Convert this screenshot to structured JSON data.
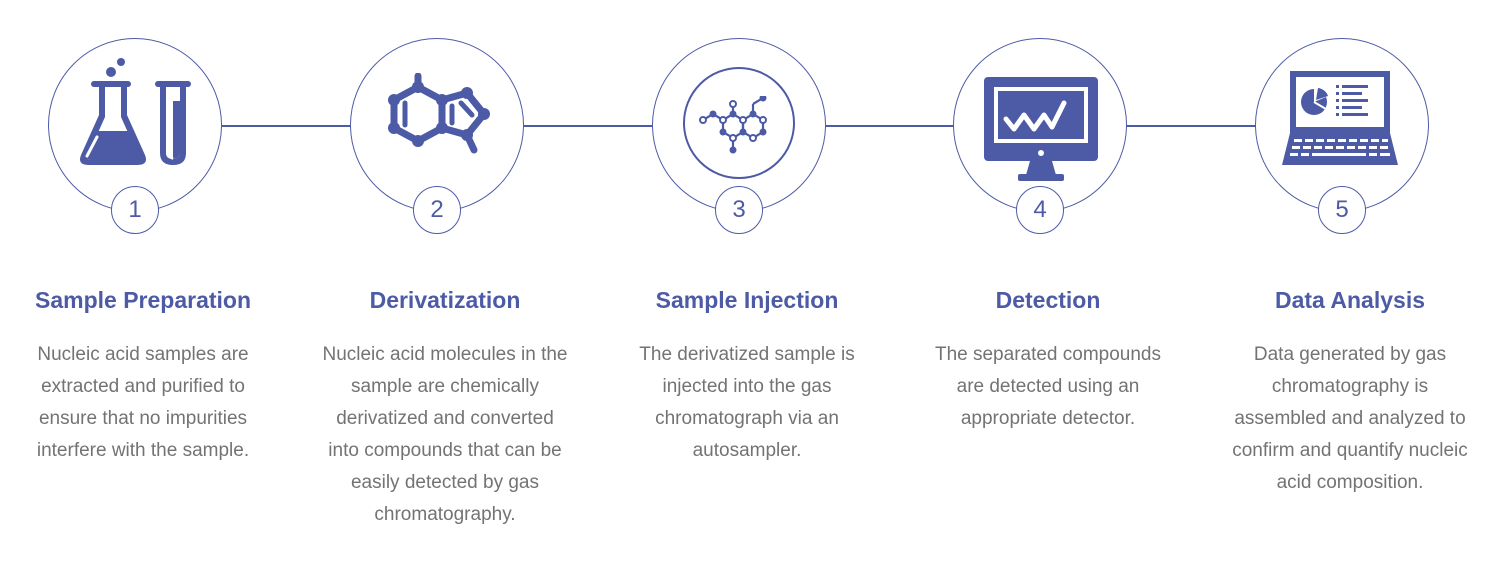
{
  "colors": {
    "accent": "#4d5ba6",
    "body_text": "#737373",
    "background": "#ffffff"
  },
  "steps": [
    {
      "number": "1",
      "icon": "flask-and-test-tube-icon",
      "title": "Sample Preparation",
      "description_lines": [
        "Nucleic acid samples are",
        "extracted and purified to",
        "ensure that no impurities",
        "interfere with the sample."
      ]
    },
    {
      "number": "2",
      "icon": "molecule-ring-icon",
      "title": "Derivatization",
      "description_lines": [
        "Nucleic acid molecules in the",
        "sample are chemically",
        "derivatized and converted",
        "into compounds that can be",
        "easily detected by gas",
        "chromatography."
      ]
    },
    {
      "number": "3",
      "icon": "molecular-structure-icon",
      "title": "Sample Injection",
      "description_lines": [
        "The derivatized sample is",
        "injected into the gas",
        "chromatograph via an",
        "autosampler."
      ]
    },
    {
      "number": "4",
      "icon": "monitor-signal-icon",
      "title": "Detection",
      "description_lines": [
        "The separated compounds",
        "are detected using an",
        "appropriate detector."
      ]
    },
    {
      "number": "5",
      "icon": "laptop-chart-icon",
      "title": "Data Analysis",
      "description_lines": [
        "Data generated by gas",
        "chromatography is",
        "assembled and analyzed to",
        "confirm and quantify nucleic",
        "acid composition."
      ]
    }
  ]
}
